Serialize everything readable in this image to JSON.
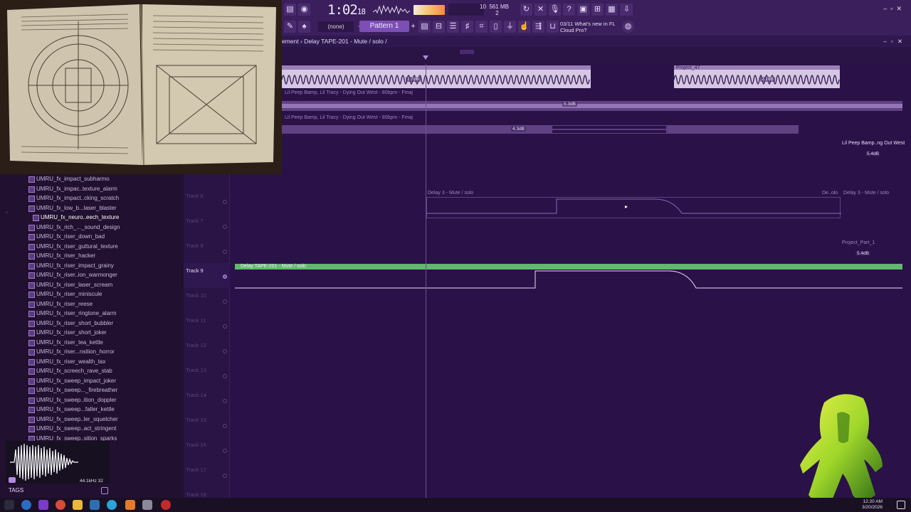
{
  "toolbar": {
    "time_main": "1:02",
    "time_sub": "18",
    "cpu_value": "10",
    "memory": "561 MB",
    "memory_sub": "2",
    "pattern_label": "Pattern 1",
    "none_label": "(none)",
    "news_count": "03/11",
    "news_text": "What's new in FL Cloud Pro?",
    "colors": {
      "accent": "#7c4fb5",
      "background": "#3b1f5c"
    }
  },
  "playlist": {
    "header_title": "ement › Delay TAPE-201 - Mute / solo /",
    "clips": {
      "audio1_db": "2.7dB",
      "audio2_label": "Project_47",
      "audio2_db": "2.2dB",
      "lil_peep1": "Lil Peep Bamp, Lil Tracy - Dying Out West - 80bpm - Fmaj",
      "lil_peep1_db": "5.3dB",
      "lil_peep2": "Lil Peep Bamp, Lil Tracy - Dying Out West - 80bpm - Fmaj",
      "lil_peep2_db": "4.3dB",
      "lil_peep_right": "Lil Peep Bamp..ng Out West",
      "lil_peep_right_db": "5.4dB",
      "delay_track6": "Delay 3 - Mute / solo",
      "delay_track6_right1": "De..olo",
      "delay_track6_right2": "Delay 3 - Mute / solo",
      "project_part": "Project_Part_1",
      "project_part_db": "5.4dB",
      "selected_clip": "Delay TAPE-201 - Mute / solo"
    },
    "tracks": [
      {
        "label": "Track 6"
      },
      {
        "label": "Track 7"
      },
      {
        "label": "Track 8"
      },
      {
        "label": "Track 9"
      },
      {
        "label": "Track 10"
      },
      {
        "label": "Track 11"
      },
      {
        "label": "Track 12"
      },
      {
        "label": "Track 13"
      },
      {
        "label": "Track 14"
      },
      {
        "label": "Track 15"
      },
      {
        "label": "Track 16"
      },
      {
        "label": "Track 17"
      },
      {
        "label": "Track 18"
      }
    ],
    "active_track": "Track 9",
    "colors": {
      "selected_clip": "#62b86e",
      "audio": "#d6c8e3"
    }
  },
  "browser": {
    "items": [
      "UMRU_fx_impact_subharmo",
      "UMRU_fx_impac..texture_alarm",
      "UMRU_fx_impact..cking_scratch",
      "UMRU_fx_low_b...laser_blaster",
      "UMRU_fx_neuro..eech_texture",
      "UMRU_fx_rich_..._sound_design",
      "UMRU_fx_riser_down_bad",
      "UMRU_fx_riser_guttural_texture",
      "UMRU_fx_riser_hacker",
      "UMRU_fx_riser_impact_grainy",
      "UMRU_fx_riser..ion_warmonger",
      "UMRU_fx_riser_laser_scream",
      "UMRU_fx_riser_miniscule",
      "UMRU_fx_riser_reese",
      "UMRU_fx_riser_ringtone_alarm",
      "UMRU_fx_riser_short_bubbler",
      "UMRU_fx_riser_short_joker",
      "UMRU_fx_riser_tea_kettle",
      "UMRU_fx_riser...nsition_horror",
      "UMRU_fx_riser_wealth_tax",
      "UMRU_fx_screech_rave_stab",
      "UMRU_fx_sweep_impact_joker",
      "UMRU_fx_sweep..._firebreather",
      "UMRU_fx_sweep..ition_doppler",
      "UMRU_fx_sweep...faller_kettle",
      "UMRU_fx_sweep..ler_squelcher",
      "UMRU_fx_sweep..act_stringent",
      "UMRU_fx_sweep..sition_sparks"
    ],
    "selected_index": 4,
    "sample_rate": "44.1kHz 32",
    "tags_label": "TAGS"
  },
  "taskbar": {
    "time": "12:20 AM",
    "date": "3/20/2026"
  }
}
